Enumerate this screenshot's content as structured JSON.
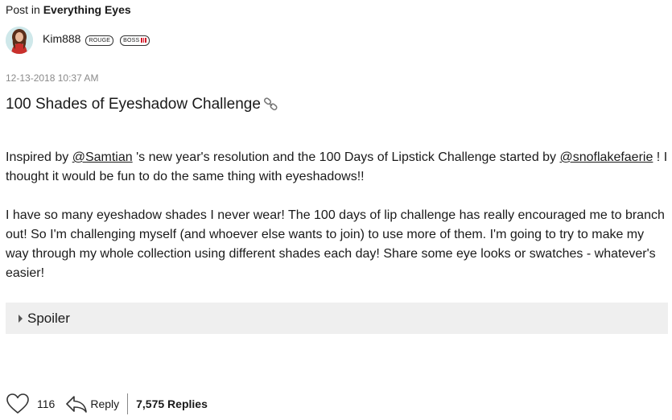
{
  "post_meta": {
    "prefix": "Post in",
    "board": "Everything Eyes"
  },
  "author": {
    "name": "Kim888",
    "badges": [
      "ROUGE",
      "BOSS"
    ],
    "boss_bars_color": "#d01a2a"
  },
  "timestamp": {
    "date": "12-13-2018",
    "time": "10:37 AM"
  },
  "post": {
    "title": "100 Shades of Eyeshadow Challenge",
    "title_icon": "link-icon",
    "paragraph1": {
      "part1": "Inspired by ",
      "mention1": "@Samtian",
      "part2": " 's new year's resolution and the 100 Days of Lipstick Challenge started by ",
      "mention2": "@snoflakefaerie",
      "part3": " ! I thought it would be fun to do the same thing with eyeshadows!!"
    },
    "paragraph2": "I have so many eyeshadow shades I never wear!  The 100 days of lip challenge has really encouraged me to branch out! So I'm challenging myself (and whoever else wants to join) to use more of them. I'm going to try to make my way through my whole collection using different shades each day! Share some eye looks or swatches - whatever's easier!"
  },
  "spoiler": {
    "label": "Spoiler",
    "icon": "caret-right-icon"
  },
  "footer": {
    "kudos_icon": "heart-icon",
    "kudos_count": "116",
    "reply_icon": "reply-arrow-icon",
    "reply_label": "Reply",
    "replies_count": "7,575 Replies"
  }
}
